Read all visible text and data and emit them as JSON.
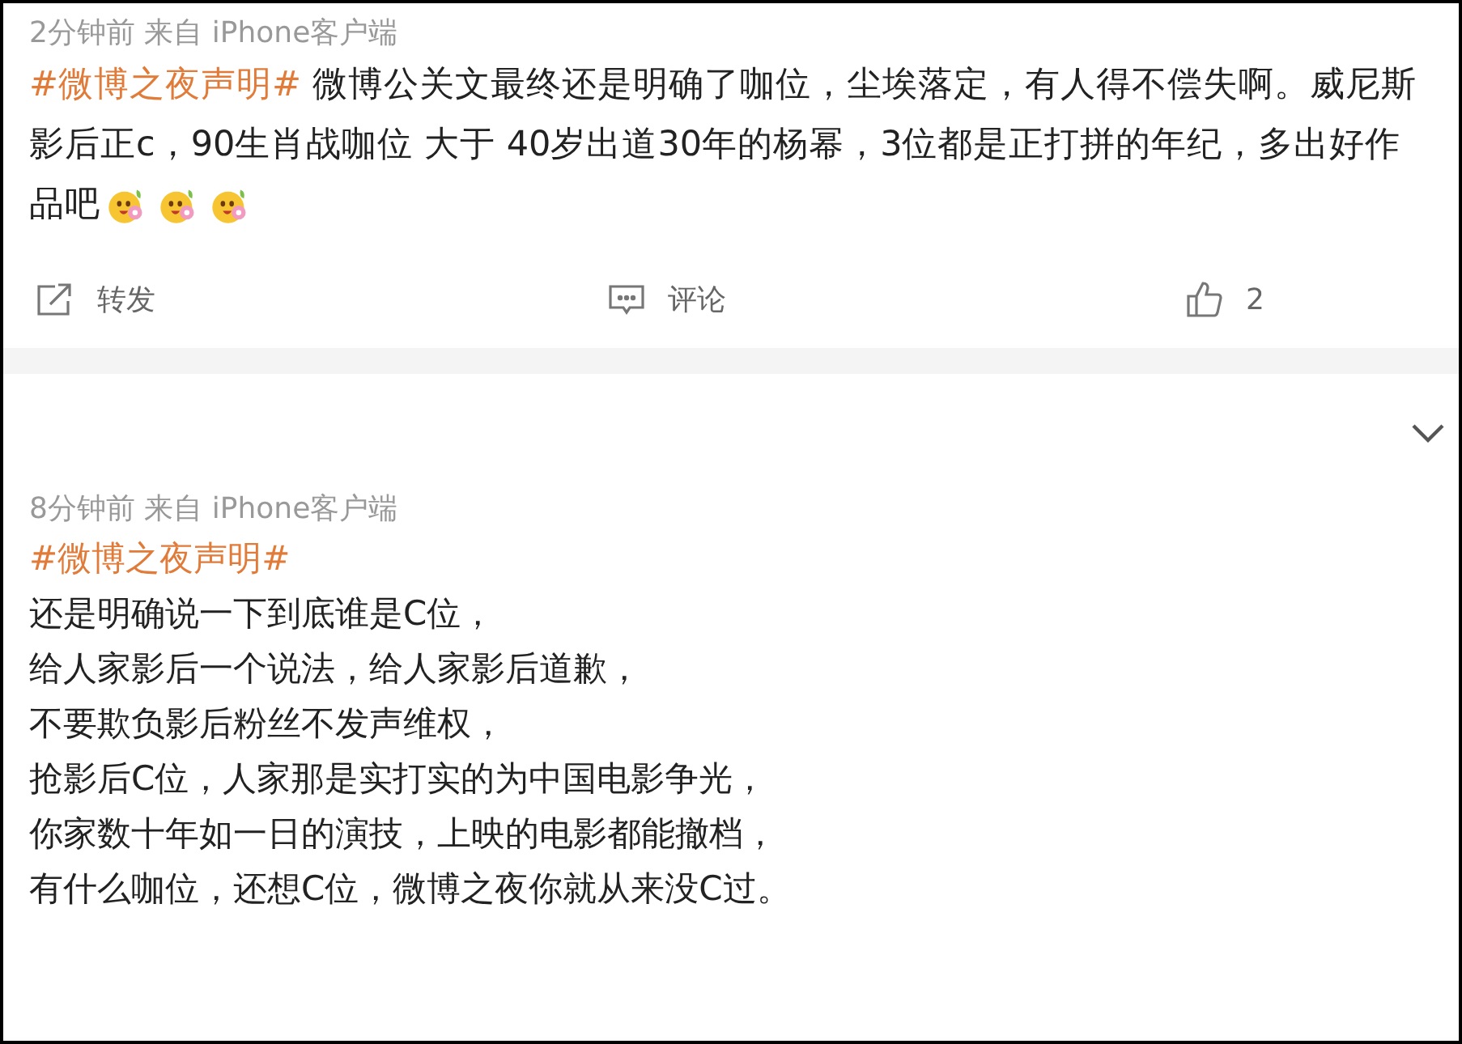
{
  "posts": [
    {
      "kind": "paragraph",
      "meta": "2分钟前  来自 iPhone客户端",
      "hashtag": "#微博之夜声明#",
      "body": " 微博公关文最终还是明确了咖位，尘埃落定，有人得不偿失啊。威尼斯影后正c，90生肖战咖位 大于 40岁出道30年的杨幂，3位都是正打拼的年纪，多出好作品吧",
      "actions": {
        "repost": "转发",
        "comment": "评论",
        "like": "2"
      }
    },
    {
      "kind": "lines",
      "meta": "8分钟前  来自 iPhone客户端",
      "hashtag": "#微博之夜声明#",
      "lines": [
        "还是明确说一下到底谁是C位，",
        "给人家影后一个说法，给人家影后道歉，",
        "不要欺负影后粉丝不发声维权，",
        "抢影后C位，人家那是实打实的为中国电影争光，",
        "你家数十年如一日的演技，上映的电影都能撤档，",
        "有什么咖位，还想C位，微博之夜你就从来没C过。"
      ]
    }
  ]
}
